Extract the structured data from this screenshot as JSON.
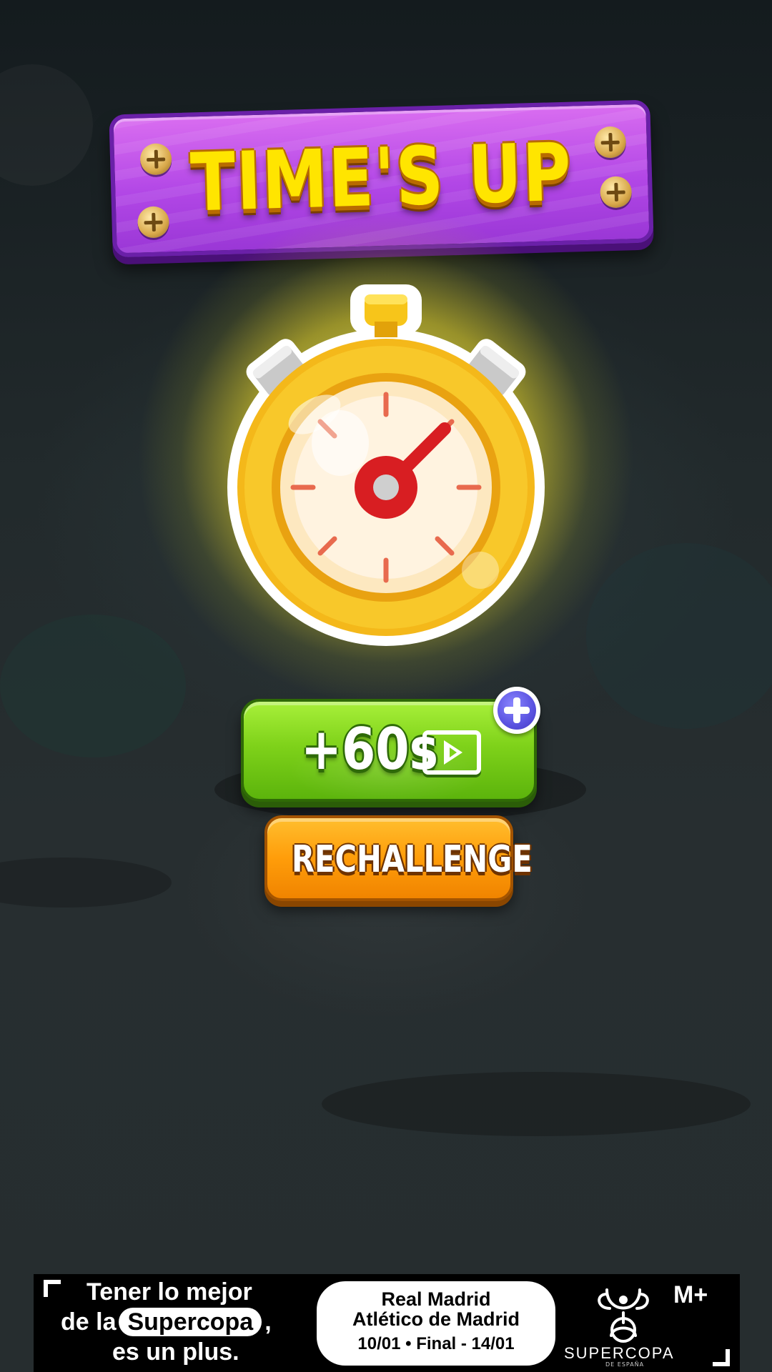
{
  "title": {
    "text": "TIME'S UP"
  },
  "bonus_button": {
    "label": "+60s",
    "icon": "video-play-icon",
    "badge_icon": "plus-icon"
  },
  "rechallenge_button": {
    "label": "RECHALLENGE"
  },
  "ad": {
    "line1": "Tener lo mejor",
    "line2_prefix": "de la",
    "line2_highlight": "Supercopa",
    "line2_suffix": ",",
    "line3": "es un plus.",
    "team1": "Real Madrid",
    "team2": "Atlético de Madrid",
    "dates": "10/01  •  Final - 14/01",
    "logo_text": "SUPERCOPA",
    "logo_subtext": "DE ESPAÑA",
    "brand": "M+"
  },
  "colors": {
    "title_plank": "#b247e6",
    "title_text": "#ffe500",
    "bonus_button": "#7fd21a",
    "rechallenge_button": "#ff9d0a",
    "badge": "#5a52e0",
    "stopwatch": "#f5c21a"
  }
}
